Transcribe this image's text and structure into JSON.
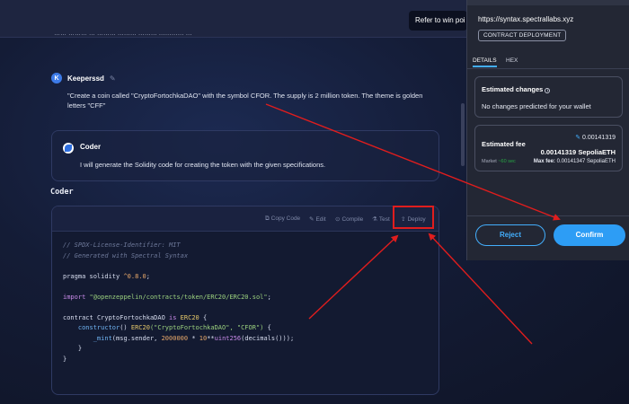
{
  "tooltip": {
    "text": "Refer to win poi"
  },
  "chat": {
    "previous_fragment": "…… ……… … ……… ……… ……… ………… …",
    "user": {
      "avatar_letter": "K",
      "name": "Keeperssd",
      "message": "\"Create a coin called \"CryptoFortochkaDAO\" with the symbol CFOR. The supply is 2 million token. The theme is golden letters \"CFF\""
    },
    "coder": {
      "name": "Coder",
      "message": "I will generate the Solidity code for creating the token with the given specifications."
    },
    "section_title": "Coder"
  },
  "code_toolbar": {
    "copy_label": "Copy Code",
    "edit_label": "Edit",
    "compile_label": "Compile",
    "test_label": "Test",
    "deploy_label": "Deploy"
  },
  "code": {
    "line1": "// SPDX-License-Identifier: MIT",
    "line2": "// Generated with Spectral Syntax",
    "pragma_kw": "pragma solidity",
    "pragma_ver": "^0.8.0",
    "import_kw": "import",
    "import_path": "\"@openzeppelin/contracts/token/ERC20/ERC20.sol\"",
    "contract_kw": "contract",
    "contract_name": "CryptoFortochkaDAO",
    "is_kw": "is",
    "base": "ERC20",
    "ctor_kw": "constructor",
    "ctor_base": "ERC20",
    "ctor_args": "(\"CryptoFortochkaDAO\", \"CFOR\")",
    "mint_fn": "_mint",
    "mint_args_a": "(msg.sender, ",
    "mint_num": "2000000",
    "mint_args_b": " * ",
    "mint_num2": "10",
    "mint_args_c": "**",
    "mint_type": "uint256",
    "mint_args_d": "(decimals()));"
  },
  "wallet": {
    "url": "https://syntax.spectrallabs.xyz",
    "badge": "CONTRACT DEPLOYMENT",
    "tabs": [
      "DETAILS",
      "HEX"
    ],
    "estimated_changes": {
      "title": "Estimated changes",
      "text": "No changes predicted for your wallet"
    },
    "fee": {
      "label": "Estimated fee",
      "fiat": "0.00141319",
      "amount": "0.00141319 SepoliaETH",
      "market_label": "Market",
      "market_time": "~60 sec",
      "max_label": "Max fee:",
      "max_value": "0.00141347 SepoliaETH"
    },
    "reject_label": "Reject",
    "confirm_label": "Confirm"
  },
  "colors": {
    "accent": "#2d9df5",
    "annotation": "#e01d1d",
    "background": "#141c36"
  }
}
